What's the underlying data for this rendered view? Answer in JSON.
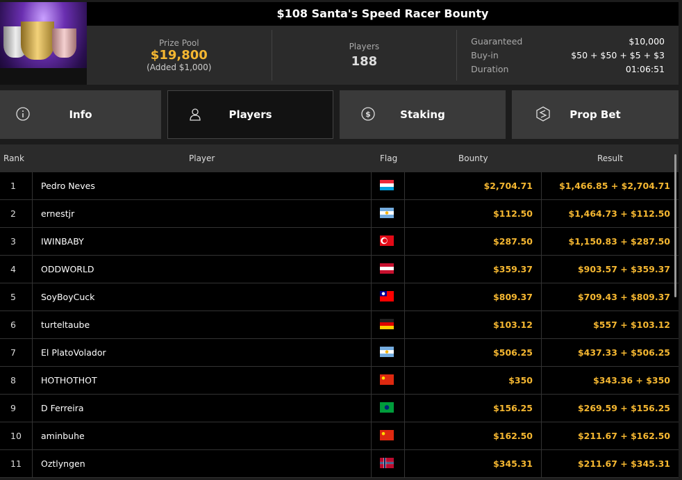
{
  "title": "$108 Santa's Speed Racer Bounty",
  "prize_pool": {
    "label": "Prize Pool",
    "value": "$19,800",
    "added": "(Added $1,000)"
  },
  "players": {
    "label": "Players",
    "value": "188"
  },
  "details": [
    {
      "label": "Guaranteed",
      "value": "$10,000"
    },
    {
      "label": "Buy-in",
      "value": "$50 + $50 + $5 + $3"
    },
    {
      "label": "Duration",
      "value": "01:06:51"
    }
  ],
  "tabs": [
    {
      "label": "Info",
      "icon": "info-icon"
    },
    {
      "label": "Players",
      "icon": "user-icon"
    },
    {
      "label": "Staking",
      "icon": "dollar-circle-icon"
    },
    {
      "label": "Prop Bet",
      "icon": "prop-bet-icon"
    }
  ],
  "columns": {
    "rank": "Rank",
    "player": "Player",
    "flag": "Flag",
    "bounty": "Bounty",
    "result": "Result"
  },
  "colors": {
    "accent": "#f5b731"
  },
  "rows": [
    {
      "rank": "1",
      "player": "Pedro Neves",
      "flag": "lu",
      "bounty": "$2,704.71",
      "result": "$1,466.85 + $2,704.71"
    },
    {
      "rank": "2",
      "player": "ernestjr",
      "flag": "ar",
      "bounty": "$112.50",
      "result": "$1,464.73 + $112.50"
    },
    {
      "rank": "3",
      "player": "IWINBABY",
      "flag": "tr",
      "bounty": "$287.50",
      "result": "$1,150.83 + $287.50"
    },
    {
      "rank": "4",
      "player": "ODDWORLD",
      "flag": "at",
      "bounty": "$359.37",
      "result": "$903.57 + $359.37"
    },
    {
      "rank": "5",
      "player": "SoyBoyCuck",
      "flag": "tw",
      "bounty": "$809.37",
      "result": "$709.43 + $809.37"
    },
    {
      "rank": "6",
      "player": "turteltaube",
      "flag": "de",
      "bounty": "$103.12",
      "result": "$557 + $103.12"
    },
    {
      "rank": "7",
      "player": "El PlatoVolador",
      "flag": "ar",
      "bounty": "$506.25",
      "result": "$437.33 + $506.25"
    },
    {
      "rank": "8",
      "player": "HOTHOTHOT",
      "flag": "cn",
      "bounty": "$350",
      "result": "$343.36 + $350"
    },
    {
      "rank": "9",
      "player": "D Ferreira",
      "flag": "br",
      "bounty": "$156.25",
      "result": "$269.59 + $156.25"
    },
    {
      "rank": "10",
      "player": "aminbuhe",
      "flag": "cn",
      "bounty": "$162.50",
      "result": "$211.67 + $162.50"
    },
    {
      "rank": "11",
      "player": "Oztlyngen",
      "flag": "no",
      "bounty": "$345.31",
      "result": "$211.67 + $345.31"
    }
  ]
}
